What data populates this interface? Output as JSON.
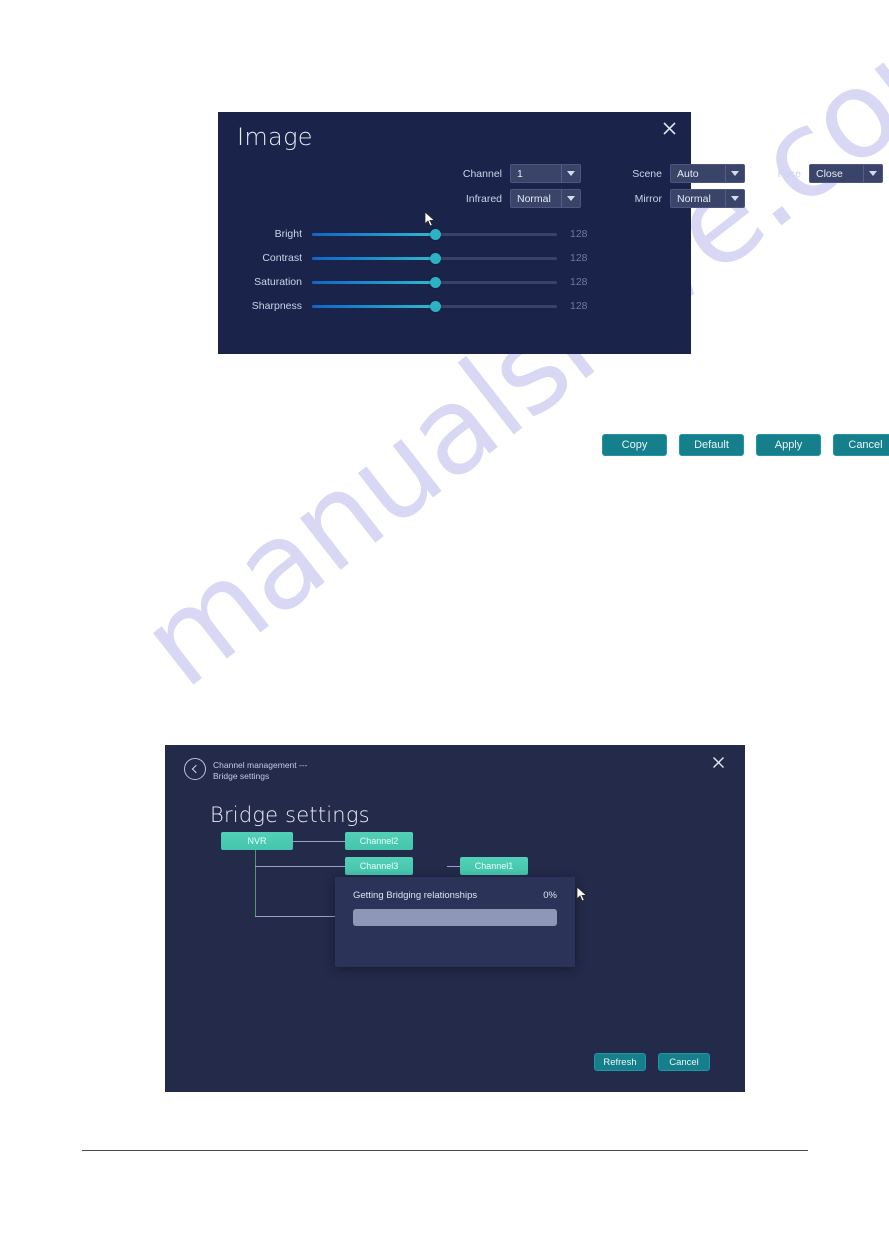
{
  "watermark": {
    "text": "manualshive.com"
  },
  "image_dialog": {
    "title": "Image",
    "close_icon": "close-icon",
    "controls": [
      {
        "label": "Channel",
        "value": "1"
      },
      {
        "label": "Scene",
        "value": "Auto"
      },
      {
        "label": "Face",
        "value": "Close"
      },
      {
        "label": "Infrared",
        "value": "Normal"
      },
      {
        "label": "Mirror",
        "value": "Normal"
      }
    ],
    "sliders": [
      {
        "label": "Bright",
        "value": "128",
        "percent": 50
      },
      {
        "label": "Contrast",
        "value": "128",
        "percent": 50
      },
      {
        "label": "Saturation",
        "value": "128",
        "percent": 50
      },
      {
        "label": "Sharpness",
        "value": "128",
        "percent": 50
      }
    ],
    "buttons": [
      {
        "label": "Copy"
      },
      {
        "label": "Default"
      },
      {
        "label": "Apply"
      },
      {
        "label": "Cancel"
      }
    ]
  },
  "bridge_dialog": {
    "breadcrumb": "Channel management ---\nBridge settings",
    "back_icon": "back-arrow-icon",
    "close_icon": "close-icon",
    "title": "Bridge settings",
    "tree": {
      "root": {
        "label": "NVR"
      },
      "nodes": [
        {
          "label": "Channel2"
        },
        {
          "label": "Channel3"
        },
        {
          "label": "Channel1"
        }
      ]
    },
    "progress": {
      "text": "Getting Bridging relationships",
      "percent_label": "0%",
      "percent": 0
    },
    "buttons": [
      {
        "label": "Refresh"
      },
      {
        "label": "Cancel"
      }
    ]
  },
  "colors": {
    "image_dialog_bg": "#1a2349",
    "bridge_dialog_bg": "#232a4a",
    "accent_button": "#157f8c",
    "node_green": "#4ecdb4",
    "slider_thumb": "#2bb3c4",
    "watermark": "#d8d8f5"
  }
}
